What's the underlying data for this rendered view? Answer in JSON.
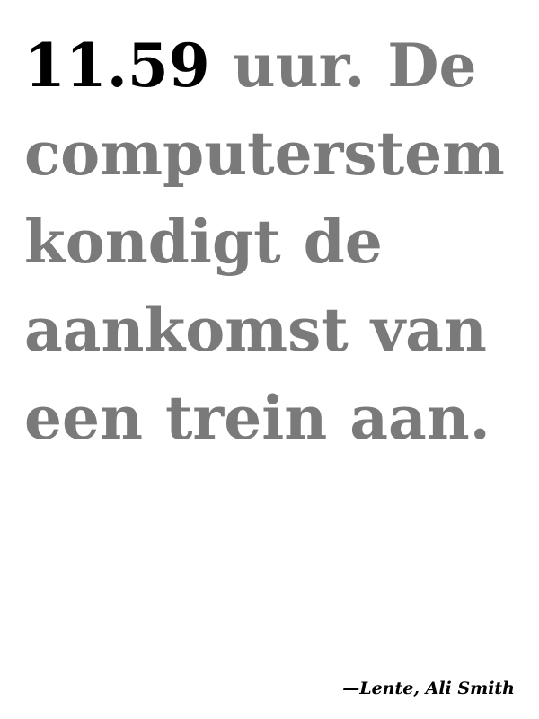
{
  "quote": {
    "time": "11.59",
    "text": " uur. De computerstem kondigt de aankomst van een trein aan."
  },
  "attribution": {
    "text": "—Lente, Ali Smith"
  },
  "colors": {
    "background": "#ffffff",
    "time": "#000000",
    "quote_text": "#7a7a7a",
    "attribution": "#000000"
  }
}
